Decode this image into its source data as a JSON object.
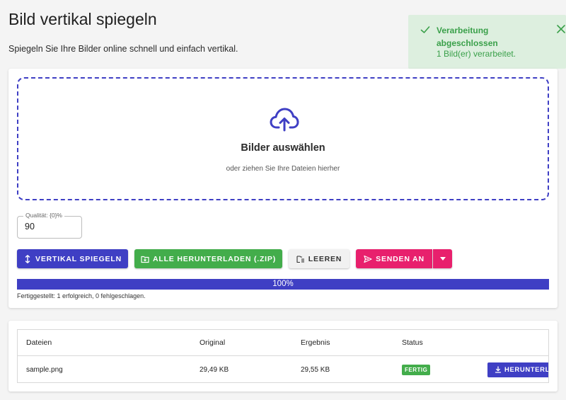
{
  "header": {
    "title": "Bild vertikal spiegeln",
    "subtitle": "Spiegeln Sie Ihre Bilder online schnell und einfach vertikal."
  },
  "toast": {
    "title": "Verarbeitung abgeschlossen",
    "message": "1 Bild(er) verarbeitet.",
    "icon": "check-icon",
    "close_icon": "close-icon",
    "color": "#3aa04a",
    "background": "#ddefdf"
  },
  "dropzone": {
    "icon": "cloud-upload-icon",
    "title": "Bilder auswählen",
    "subtitle": "oder ziehen Sie Ihre Dateien hierher"
  },
  "quality": {
    "label": "Qualität: {0}%",
    "value": "90"
  },
  "toolbar": {
    "flip_label": "Vertikal spiegeln",
    "download_all_label": "Alle herunterladen (.zip)",
    "clear_label": "Leeren",
    "send_label": "Senden an"
  },
  "progress": {
    "percent": 100,
    "label": "100%",
    "summary": "Fertiggestellt: 1 erfolgreich, 0 fehlgeschlagen."
  },
  "table": {
    "headers": [
      "Dateien",
      "Original",
      "Ergebnis",
      "Status",
      ""
    ],
    "rows": [
      {
        "file": "sample.png",
        "original": "29,49 KB",
        "result": "29,55 KB",
        "status": "FERTIG",
        "action": "HERUNTERLADEN"
      }
    ]
  },
  "colors": {
    "primary": "#3f3fc4",
    "success": "#43ad4b",
    "accent": "#e8206d"
  }
}
